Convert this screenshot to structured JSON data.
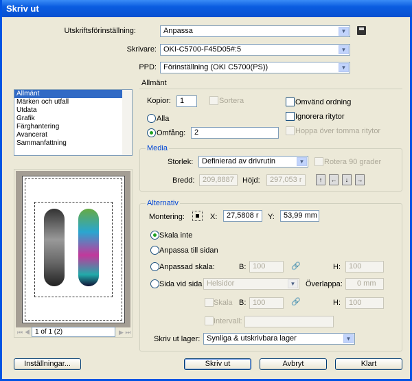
{
  "window": {
    "title": "Skriv ut"
  },
  "top": {
    "preset_label": "Utskriftsförinställning:",
    "preset_value": "Anpassa",
    "printer_label": "Skrivare:",
    "printer_value": "OKI-C5700-F45D05#:5",
    "ppd_label": "PPD:",
    "ppd_value": "Förinställning (OKI C5700(PS))"
  },
  "sidebar": {
    "items": [
      "Allmänt",
      "Märken och utfall",
      "Utdata",
      "Grafik",
      "Färghantering",
      "Avancerat",
      "Sammanfattning"
    ],
    "selected": "Allmänt"
  },
  "preview": {
    "pager": "1 of 1 (2)"
  },
  "general": {
    "heading": "Allmänt",
    "copies_label": "Kopior:",
    "copies_value": "1",
    "collate_label": "Sortera",
    "all_label": "Alla",
    "range_label": "Omfång:",
    "range_value": "2",
    "reverse_label": "Omvänd ordning",
    "ignore_label": "Ignorera ritytor",
    "skip_label": "Hoppa över tomma ritytor"
  },
  "media": {
    "legend": "Media",
    "size_label": "Storlek:",
    "size_value": "Definierad av drivrutin",
    "rotate_label": "Rotera 90 grader",
    "width_label": "Bredd:",
    "width_value": "209,8887",
    "height_label": "Höjd:",
    "height_value": "297,053 r"
  },
  "options": {
    "legend": "Alternativ",
    "mount_label": "Montering:",
    "x_label": "X:",
    "x_value": "27,5808 r",
    "y_label": "Y:",
    "y_value": "53,99 mm",
    "no_scale": "Skala inte",
    "fit_page": "Anpassa till sidan",
    "custom_scale": "Anpassad skala:",
    "tile": "Sida vid sida",
    "tile_value": "Helsidor",
    "overlap_label": "Överlappa:",
    "overlap_value": "0 mm",
    "b_label": "B:",
    "h_label": "H:",
    "b_value": "100",
    "h_value": "100",
    "scale_label": "Skala",
    "interval_label": "Intervall:",
    "layers_label": "Skriv ut lager:",
    "layers_value": "Synliga & utskrivbara lager"
  },
  "buttons": {
    "settings": "Inställningar...",
    "print": "Skriv ut",
    "cancel": "Avbryt",
    "done": "Klart"
  }
}
